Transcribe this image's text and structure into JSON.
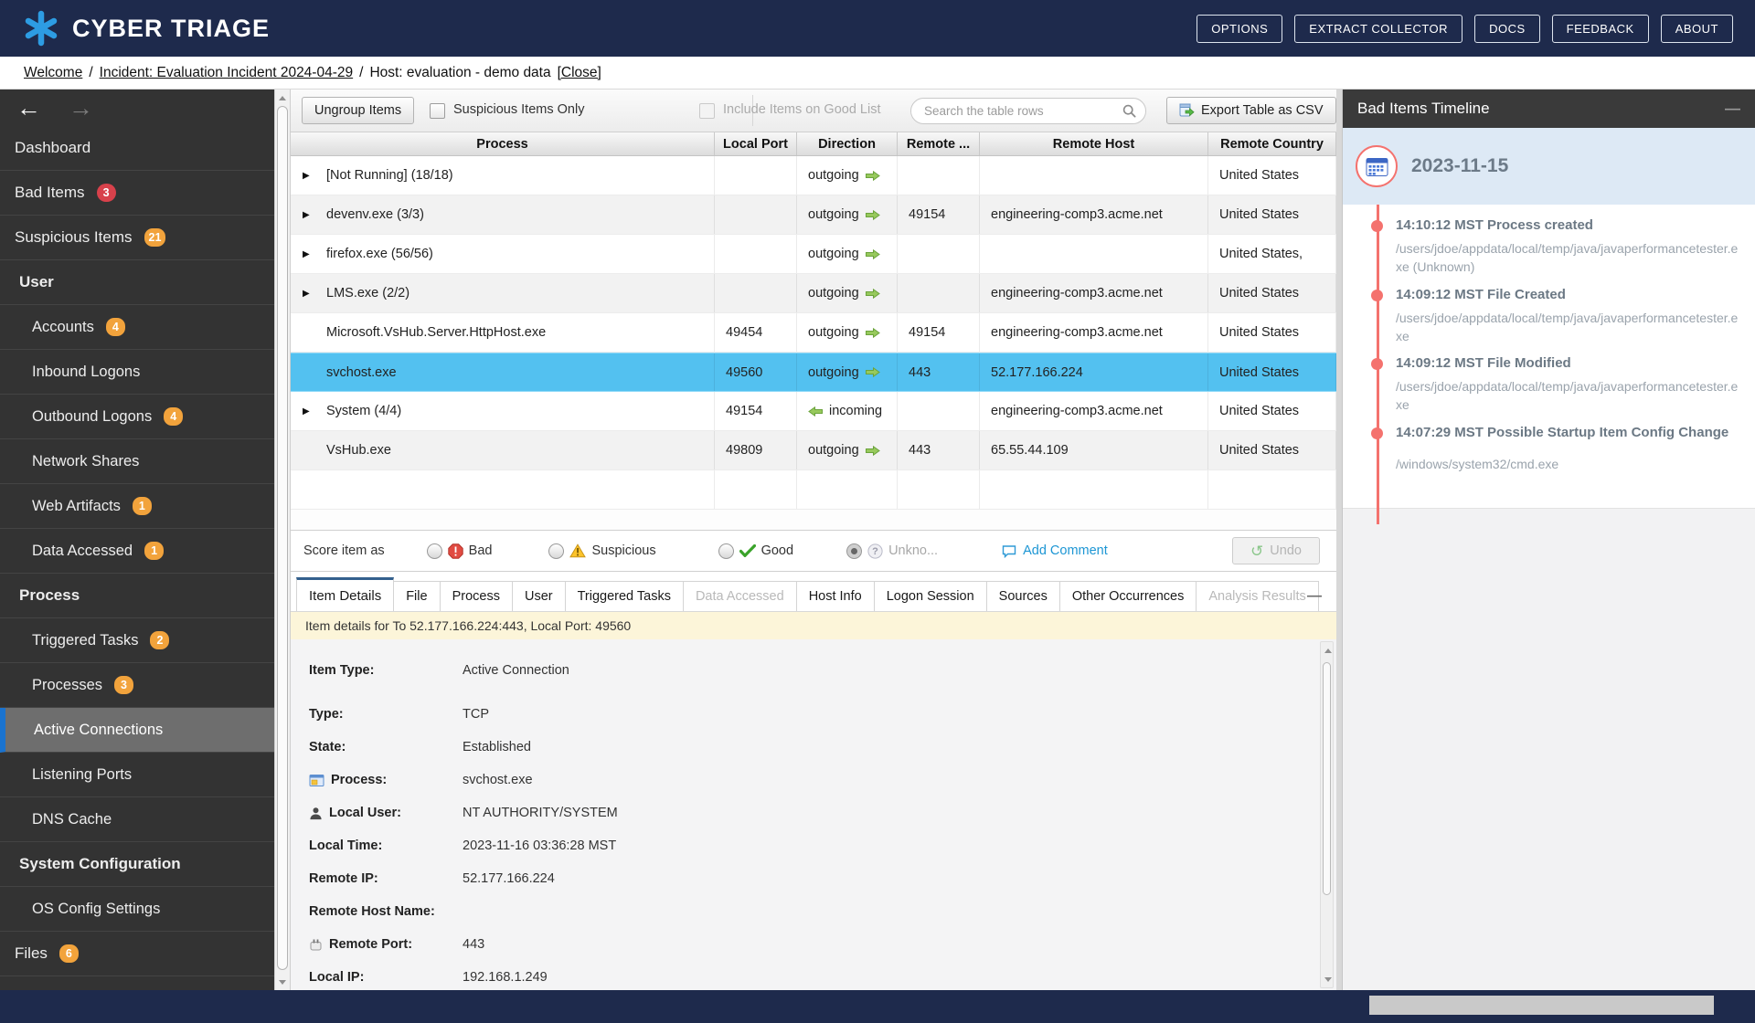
{
  "topbar": {
    "brand": "CYBER TRIAGE",
    "buttons": [
      {
        "label": "OPTIONS"
      },
      {
        "label": "EXTRACT COLLECTOR"
      },
      {
        "label": "DOCS"
      },
      {
        "label": "FEEDBACK"
      },
      {
        "label": "ABOUT"
      }
    ]
  },
  "breadcrumb": {
    "welcome": "Welcome",
    "separator": "/",
    "incident": "Incident: Evaluation Incident 2024-04-29",
    "host": "Host: evaluation - demo data",
    "close": "[Close]"
  },
  "sidebar": {
    "items": [
      {
        "label": "Dashboard"
      },
      {
        "label": "Bad Items",
        "badge": "3"
      },
      {
        "label": "Suspicious Items",
        "badge": "21"
      },
      {
        "label": "User"
      },
      {
        "label": "Accounts",
        "badge": "4"
      },
      {
        "label": "Inbound Logons"
      },
      {
        "label": "Outbound Logons",
        "badge": "4"
      },
      {
        "label": "Network Shares"
      },
      {
        "label": "Web Artifacts",
        "badge": "1"
      },
      {
        "label": "Data Accessed",
        "badge": "1"
      },
      {
        "label": "Process"
      },
      {
        "label": "Triggered Tasks",
        "badge": "2"
      },
      {
        "label": "Processes",
        "badge": "3"
      },
      {
        "label": "Active Connections",
        "selected": true
      },
      {
        "label": "Listening Ports"
      },
      {
        "label": "DNS Cache"
      },
      {
        "label": "System Configuration"
      },
      {
        "label": "OS Config Settings"
      },
      {
        "label": "Files",
        "badge": "6"
      }
    ]
  },
  "toolbar": {
    "ungroup": "Ungroup Items",
    "suspicious_only": "Suspicious Items Only",
    "include_good": "Include Items on Good List",
    "search_placeholder": "Search the table rows",
    "export_csv": "Export Table as CSV"
  },
  "table": {
    "columns": [
      "Process",
      "Local Port",
      "Direction",
      "Remote ...",
      "Remote Host",
      "Remote Country"
    ],
    "rows": [
      {
        "process": "[Not Running] (18/18)",
        "local_port": "",
        "direction": "outgoing",
        "remote_port": "",
        "remote_host": "",
        "remote_country": "United States"
      },
      {
        "process": "devenv.exe (3/3)",
        "local_port": "",
        "direction": "outgoing",
        "remote_port": "49154",
        "remote_host": "engineering-comp3.acme.net",
        "remote_country": "United States"
      },
      {
        "process": "firefox.exe (56/56)",
        "local_port": "",
        "direction": "outgoing",
        "remote_port": "",
        "remote_host": "",
        "remote_country": "United States,"
      },
      {
        "process": "LMS.exe (2/2)",
        "local_port": "",
        "direction": "outgoing",
        "remote_port": "",
        "remote_host": "engineering-comp3.acme.net",
        "remote_country": "United States"
      },
      {
        "process": "Microsoft.VsHub.Server.HttpHost.exe",
        "local_port": "49454",
        "direction": "outgoing",
        "remote_port": "49154",
        "remote_host": "engineering-comp3.acme.net",
        "remote_country": "United States"
      },
      {
        "process": "svchost.exe",
        "local_port": "49560",
        "direction": "outgoing",
        "remote_port": "443",
        "remote_host": "52.177.166.224",
        "remote_country": "United States"
      },
      {
        "process": "System (4/4)",
        "local_port": "49154",
        "direction": "incoming",
        "remote_port": "",
        "remote_host": "engineering-comp3.acme.net",
        "remote_country": "United States"
      },
      {
        "process": "VsHub.exe",
        "local_port": "49809",
        "direction": "outgoing",
        "remote_port": "443",
        "remote_host": "65.55.44.109",
        "remote_country": "United States"
      }
    ]
  },
  "score_bar": {
    "label": "Score item as",
    "bad": "Bad",
    "suspicious": "Suspicious",
    "good": "Good",
    "unknown": "Unkno...",
    "add_comment": "Add Comment",
    "undo": "Undo"
  },
  "tabs": [
    {
      "label": "Item Details",
      "state": "active"
    },
    {
      "label": "File"
    },
    {
      "label": "Process"
    },
    {
      "label": "User"
    },
    {
      "label": "Triggered Tasks"
    },
    {
      "label": "Data Accessed",
      "state": "disabled"
    },
    {
      "label": "Host Info"
    },
    {
      "label": "Logon Session"
    },
    {
      "label": "Sources"
    },
    {
      "label": "Other Occurrences"
    },
    {
      "label": "Analysis Results",
      "state": "disabled"
    }
  ],
  "detail": {
    "banner": "Item details for To 52.177.166.224:443, Local Port: 49560",
    "fields": [
      {
        "label": "Item Type:",
        "value": "Active Connection"
      },
      {
        "label": "Type:",
        "value": "TCP"
      },
      {
        "label": "State:",
        "value": "Established"
      },
      {
        "label": "Process:",
        "value": "svchost.exe"
      },
      {
        "label": "Local User:",
        "value": "NT AUTHORITY/SYSTEM"
      },
      {
        "label": "Local Time:",
        "value": "2023-11-16 03:36:28 MST"
      },
      {
        "label": "Remote IP:",
        "value": "52.177.166.224"
      },
      {
        "label": "Remote Host Name:",
        "value": ""
      },
      {
        "label": "Remote Port:",
        "value": "443"
      },
      {
        "label": "Local IP:",
        "value": "192.168.1.249"
      }
    ]
  },
  "timeline": {
    "title": "Bad Items Timeline",
    "date": "2023-11-15",
    "events": [
      {
        "title": "14:10:12 MST Process created",
        "path": "/users/jdoe/appdata/local/temp/java/javaperformancetester.exe (Unknown)"
      },
      {
        "title": "14:09:12 MST File Created",
        "path": "/users/jdoe/appdata/local/temp/java/javaperformancetester.exe"
      },
      {
        "title": "14:09:12 MST File Modified",
        "path": "/users/jdoe/appdata/local/temp/java/javaperformancetester.exe"
      },
      {
        "title": "14:07:29 MST Possible Startup Item Config Change",
        "path": "/windows/system32/cmd.exe"
      }
    ]
  },
  "colors": {
    "navy": "#1e2a4c",
    "logo_blue": "#2d9ce3",
    "badge_red": "#d8414b",
    "badge_orange": "#f2a33c",
    "selected_row_blue": "#53c1f0",
    "active_tab_blue": "#33608d",
    "timeline_red": "#f4726e",
    "sidebar_dark": "#333333"
  }
}
